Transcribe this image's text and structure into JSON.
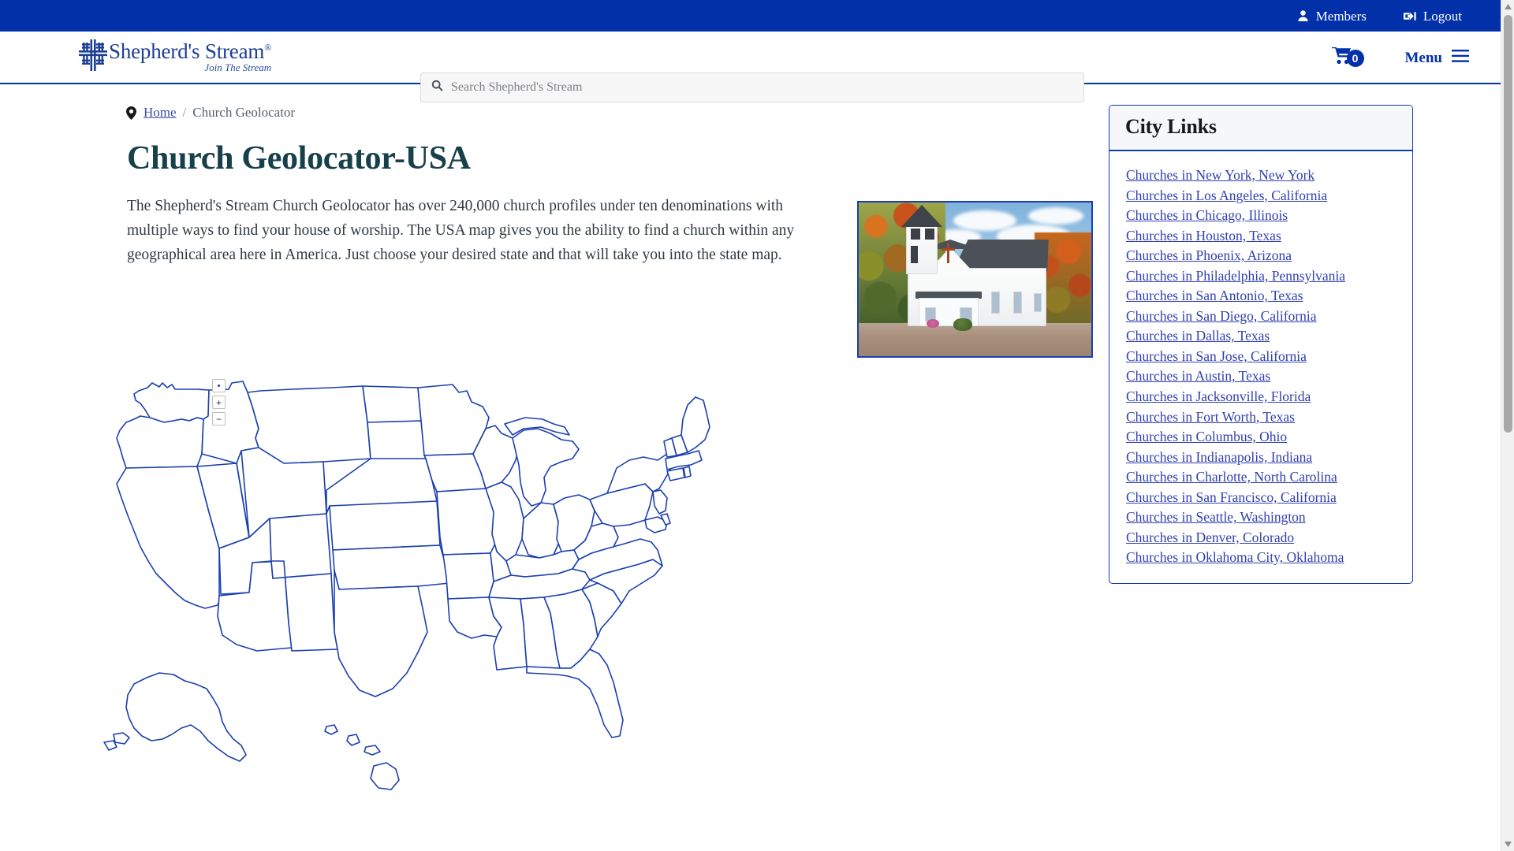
{
  "topbar": {
    "members_label": "Members",
    "logout_label": "Logout",
    "bg_color": "#0230a8"
  },
  "header": {
    "logo_main": "Shepherd's Stream",
    "logo_registered": "®",
    "logo_tagline": "Join The Stream",
    "search_placeholder": "Search Shepherd's Stream",
    "search_value": "",
    "cart_count": "0",
    "menu_label": "Menu",
    "brand_color": "#0230a8",
    "logo_text_color": "#1c3f94"
  },
  "breadcrumb": {
    "home_label": "Home",
    "separator": "/",
    "current_label": "Church Geolocator"
  },
  "main": {
    "title": "Church Geolocator-USA",
    "title_color": "#17404a",
    "description": "The Shepherd's Stream Church Geolocator has over 240,000 church profiles under ten denominations with multiple ways to find your house of worship. The USA map gives you the ability to find a church within any geographical area here in America. Just choose your desired state and that will take you into the state map.",
    "photo_alt": "White country church with autumn foliage"
  },
  "map": {
    "reset_label": "·",
    "zoom_in_label": "+",
    "zoom_out_label": "−",
    "stroke_color": "#1a3fb0",
    "fill_color": "#ffffff"
  },
  "sidebar": {
    "card_title": "City Links",
    "links": [
      "Churches in New York, New York",
      "Churches in Los Angeles, California",
      "Churches in Chicago, Illinois",
      "Churches in Houston, Texas",
      "Churches in Phoenix, Arizona",
      "Churches in Philadelphia, Pennsylvania",
      "Churches in San Antonio, Texas",
      "Churches in San Diego, California",
      "Churches in Dallas, Texas",
      "Churches in San Jose, California",
      "Churches in Austin, Texas",
      "Churches in Jacksonville, Florida",
      "Churches in Fort Worth, Texas",
      "Churches in Columbus, Ohio",
      "Churches in Indianapolis, Indiana",
      "Churches in Charlotte, North Carolina",
      "Churches in San Francisco, California",
      "Churches in Seattle, Washington",
      "Churches in Denver, Colorado",
      "Churches in Oklahoma City, Oklahoma"
    ]
  }
}
